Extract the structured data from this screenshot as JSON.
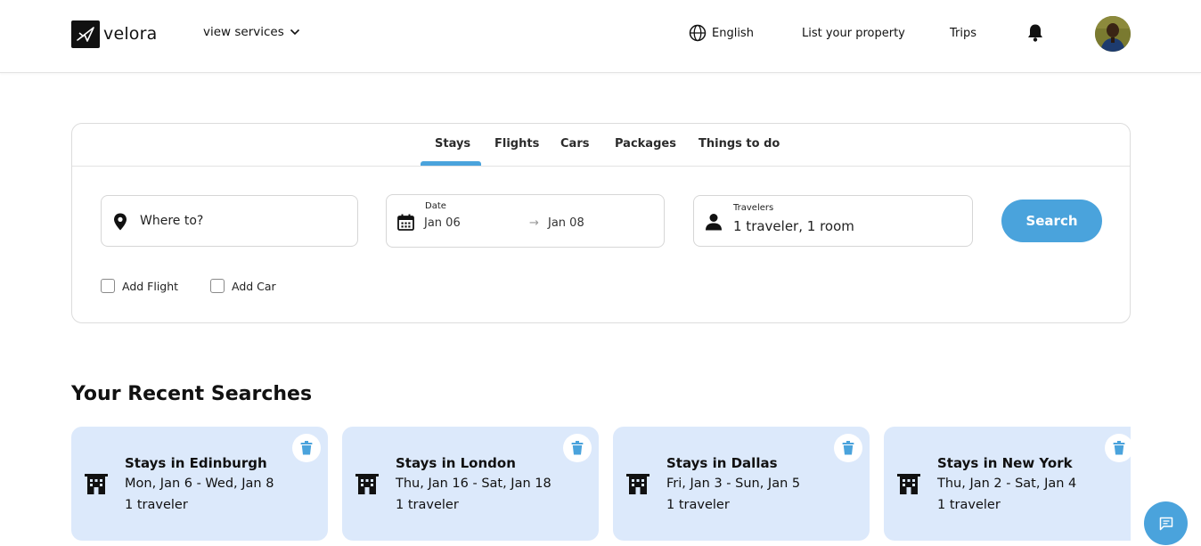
{
  "header": {
    "brand": "velora",
    "services_label": "view services",
    "language": "English",
    "list_property": "List your property",
    "trips": "Trips"
  },
  "tabs": [
    "Stays",
    "Flights",
    "Cars",
    "Packages",
    "Things to do"
  ],
  "active_tab": "Stays",
  "search": {
    "where_placeholder": "Where to?",
    "date_label": "Date",
    "start_date": "Jan 06",
    "end_date": "Jan 08",
    "date_arrow": "→",
    "travelers_label": "Travelers",
    "travelers_value": "1 traveler, 1 room",
    "button": "Search",
    "add_flight": "Add Flight",
    "add_car": "Add Car"
  },
  "recent": {
    "title": "Your Recent Searches",
    "items": [
      {
        "title": "Stays in Edinburgh",
        "dates": "Mon, Jan 6 - Wed, Jan 8",
        "travelers": "1 traveler"
      },
      {
        "title": "Stays in London",
        "dates": "Thu, Jan 16 - Sat, Jan 18",
        "travelers": "1 traveler"
      },
      {
        "title": "Stays in Dallas",
        "dates": "Fri, Jan 3 - Sun, Jan 5",
        "travelers": "1 traveler"
      },
      {
        "title": "Stays in New York",
        "dates": "Thu, Jan 2 - Sat, Jan 4",
        "travelers": "1 traveler"
      }
    ]
  },
  "colors": {
    "accent": "#4aa3dc",
    "card_bg": "#dce9fb"
  }
}
